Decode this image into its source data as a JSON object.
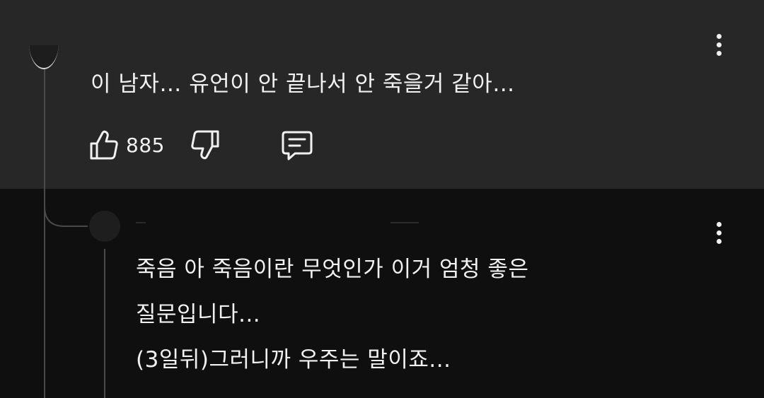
{
  "comment": {
    "text": "이 남자… 유언이 안 끝나서 안 죽을거 같아…",
    "like_count": "885",
    "icons": {
      "like": "thumbs-up-icon",
      "dislike": "thumbs-down-icon",
      "reply": "comment-reply-icon",
      "more": "more-vertical-icon"
    }
  },
  "reply": {
    "lines": [
      "죽음 아 죽음이란 무엇인가 이거 엄청 좋은",
      "질문입니다...",
      "(3일뒤)그러니까 우주는 말이죠..."
    ],
    "icons": {
      "more": "more-vertical-icon"
    }
  },
  "colors": {
    "top_panel": "#272727",
    "bottom_panel": "#0f0f0f",
    "text": "#f1f1f1",
    "thread_line": "#4a4a4a"
  }
}
